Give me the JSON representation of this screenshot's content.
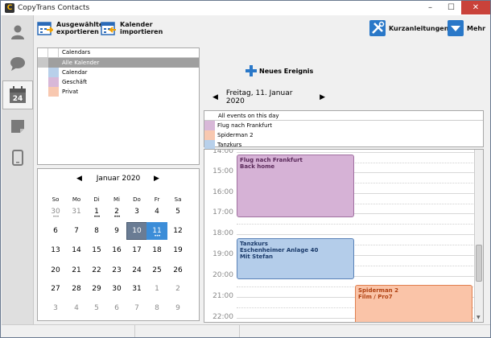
{
  "window": {
    "title": "CopyTrans Contacts",
    "minimize": "–",
    "maximize": "☐",
    "close": "✕"
  },
  "sidebar": {
    "items": [
      "contacts",
      "messages",
      "calendar",
      "notes",
      "device"
    ]
  },
  "toolbar": {
    "export_label": "Ausgewählte exportieren",
    "import_label": "Kalender importieren",
    "guides_label": "Kurzanleitungen",
    "more_label": "Mehr"
  },
  "calendars": {
    "header": "Calendars",
    "items": [
      {
        "label": "Alle Kalender",
        "color": ""
      },
      {
        "label": "Calendar",
        "color": "#b8d0ea"
      },
      {
        "label": "Geschäft",
        "color": "#d8b8d8"
      },
      {
        "label": "Privat",
        "color": "#f8c8b0"
      }
    ]
  },
  "mini_calendar": {
    "month": "Januar 2020",
    "prev": "◀",
    "next": "▶",
    "weekdays": [
      "So",
      "Mo",
      "Di",
      "Mi",
      "Do",
      "Fr",
      "Sa"
    ],
    "weeks": [
      [
        "30",
        "31",
        "1",
        "2",
        "3",
        "4",
        "5"
      ],
      [
        "6",
        "7",
        "8",
        "9",
        "10",
        "11",
        "12"
      ],
      [
        "13",
        "14",
        "15",
        "16",
        "17",
        "18",
        "19"
      ],
      [
        "20",
        "21",
        "22",
        "23",
        "24",
        "25",
        "26"
      ],
      [
        "27",
        "28",
        "29",
        "30",
        "31",
        "1",
        "2"
      ],
      [
        "3",
        "4",
        "5",
        "6",
        "7",
        "8",
        "9"
      ]
    ]
  },
  "new_event": {
    "label": "Neues Ereignis"
  },
  "day_view": {
    "date": "Freitag, 11. Januar 2020",
    "prev": "◀",
    "next": "▶",
    "all_events_header": "All events on this day",
    "all_events": [
      {
        "label": "Flug nach Frankfurt",
        "color": "#d8b8d8"
      },
      {
        "label": "Spiderman 2",
        "color": "#f8c8b0"
      },
      {
        "label": "Tanzkurs",
        "color": "#b8d0ea"
      }
    ],
    "times": [
      "14:00",
      "15:00",
      "16:00",
      "17:00",
      "18:00",
      "19:00",
      "20:00",
      "21:00",
      "22:00"
    ],
    "events": [
      {
        "line1": "Flug nach Frankfurt",
        "line2": "Back home",
        "line3": "",
        "color": "#d6b2d6",
        "border": "#a070a0",
        "text": "#5a2a5a"
      },
      {
        "line1": "Tanzkurs",
        "line2": "Eschenheimer Anlage 40",
        "line3": "Mit Stefan",
        "color": "#b4cdea",
        "border": "#5a82b8",
        "text": "#1a3a6a"
      },
      {
        "line1": "Spiderman 2",
        "line2": "Film / Pro7",
        "line3": "",
        "color": "#fac4a8",
        "border": "#e08050",
        "text": "#b04010"
      }
    ]
  }
}
